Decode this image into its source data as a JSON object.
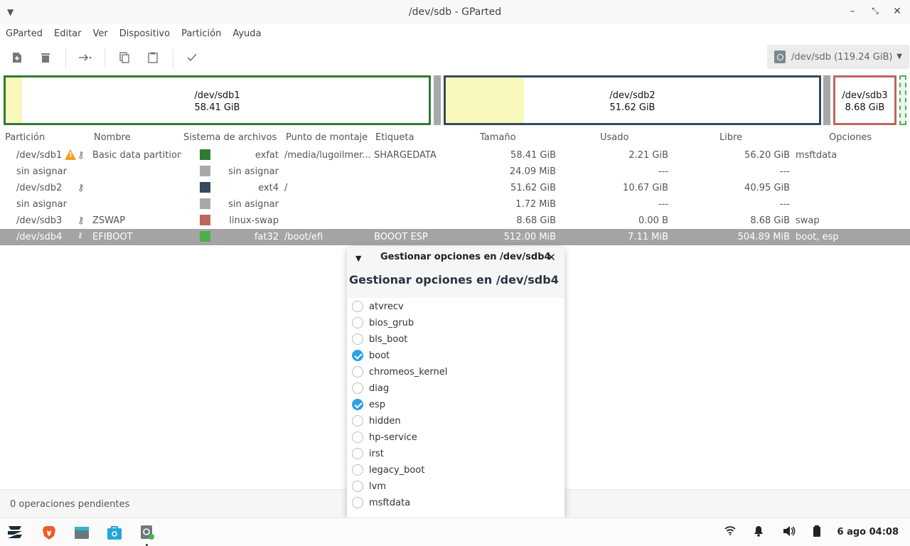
{
  "window": {
    "title": "/dev/sdb - GParted"
  },
  "menu": [
    "GParted",
    "Editar",
    "Ver",
    "Dispositivo",
    "Partición",
    "Ayuda"
  ],
  "device_selector": {
    "label": "/dev/sdb (119.24 GiB)"
  },
  "map": {
    "sdb1": {
      "name": "/dev/sdb1",
      "size": "58.41 GiB",
      "color": "#2e7d32",
      "used_fraction": 0.04
    },
    "sdb2": {
      "name": "/dev/sdb2",
      "size": "51.62 GiB",
      "color": "#34495e",
      "used_fraction": 0.21
    },
    "sdb3": {
      "name": "/dev/sdb3",
      "size": "8.68 GiB",
      "color": "#c0655c",
      "used_fraction": 0.0
    }
  },
  "columns": [
    "Partición",
    "Nombre",
    "Sistema de archivos",
    "Punto de montaje",
    "Etiqueta",
    "Tamaño",
    "Usado",
    "Libre",
    "Opciones"
  ],
  "rows": [
    {
      "partition": "/dev/sdb1",
      "name": "Basic data partition",
      "fs": "exfat",
      "fs_color": "#2e7d32",
      "mount": "/media/lugoilmer...",
      "label": "SHARGEDATA",
      "size": "58.41 GiB",
      "used": "2.21 GiB",
      "free": "56.20 GiB",
      "flags": "msftdata"
    },
    {
      "partition": "sin asignar",
      "name": "",
      "fs": "sin asignar",
      "fs_color": "#a8a8a8",
      "mount": "",
      "label": "",
      "size": "24.09 MiB",
      "used": "---",
      "free": "---",
      "flags": ""
    },
    {
      "partition": "/dev/sdb2",
      "name": "",
      "fs": "ext4",
      "fs_color": "#34495e",
      "mount": "/",
      "label": "",
      "size": "51.62 GiB",
      "used": "10.67 GiB",
      "free": "40.95 GiB",
      "flags": ""
    },
    {
      "partition": "sin asignar",
      "name": "",
      "fs": "sin asignar",
      "fs_color": "#a8a8a8",
      "mount": "",
      "label": "",
      "size": "1.72 MiB",
      "used": "---",
      "free": "---",
      "flags": ""
    },
    {
      "partition": "/dev/sdb3",
      "name": "ZSWAP",
      "fs": "linux-swap",
      "fs_color": "#c0655c",
      "mount": "",
      "label": "",
      "size": "8.68 GiB",
      "used": "0.00 B",
      "free": "8.68 GiB",
      "flags": "swap"
    },
    {
      "partition": "/dev/sdb4",
      "name": "EFIBOOT",
      "fs": "fat32",
      "fs_color": "#4caf50",
      "mount": "/boot/efi",
      "label": "BOOOT ESP",
      "size": "512.00 MiB",
      "used": "7.11 MiB",
      "free": "504.89 MiB",
      "flags": "boot, esp"
    }
  ],
  "status": {
    "pending": "0 operaciones pendientes"
  },
  "dialog": {
    "window_title": "Gestionar opciones en /dev/sdb4",
    "heading": "Gestionar opciones en /dev/sdb4",
    "flags": [
      {
        "name": "atvrecv",
        "checked": false
      },
      {
        "name": "bios_grub",
        "checked": false
      },
      {
        "name": "bls_boot",
        "checked": false
      },
      {
        "name": "boot",
        "checked": true
      },
      {
        "name": "chromeos_kernel",
        "checked": false
      },
      {
        "name": "diag",
        "checked": false
      },
      {
        "name": "esp",
        "checked": true
      },
      {
        "name": "hidden",
        "checked": false
      },
      {
        "name": "hp-service",
        "checked": false
      },
      {
        "name": "irst",
        "checked": false
      },
      {
        "name": "legacy_boot",
        "checked": false
      },
      {
        "name": "lvm",
        "checked": false
      },
      {
        "name": "msftdata",
        "checked": false
      }
    ]
  },
  "taskbar": {
    "clock": "6 ago 04:08"
  }
}
